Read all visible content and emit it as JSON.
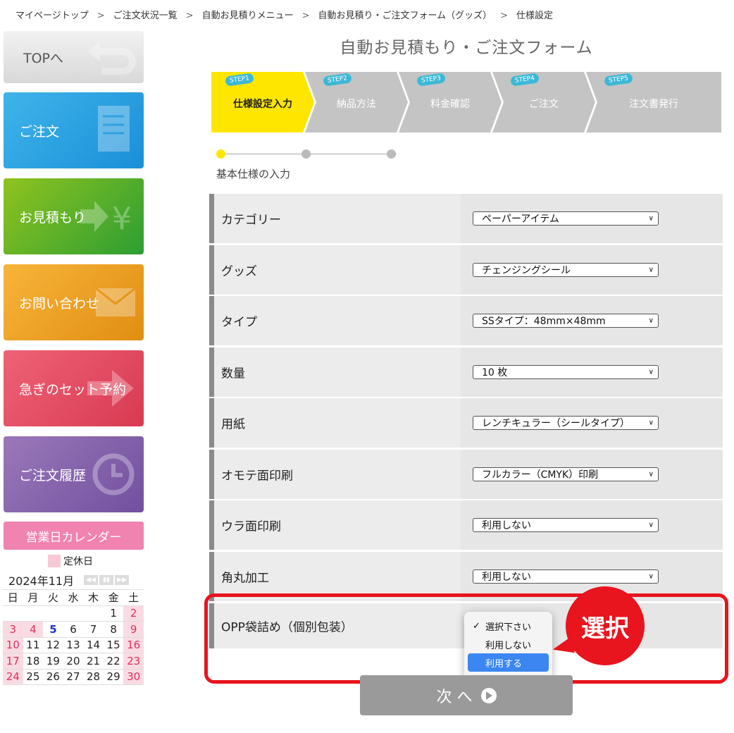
{
  "breadcrumb": {
    "items": [
      "マイページトップ",
      "ご注文状況一覧",
      "自動お見積りメニュー",
      "自動お見積り・ご注文フォーム（グッズ）",
      "仕様設定"
    ],
    "separator": ">"
  },
  "sidebar": {
    "top": "TOPへ",
    "order": "ご注文",
    "estimate": "お見積もり",
    "inquiry": "お問い合わせ",
    "rush": "急ぎのセット予約",
    "history": "ご注文履歴"
  },
  "calendar": {
    "title": "営業日カレンダー",
    "legend": "定休日",
    "month": "2024年11月",
    "weekdays": [
      "日",
      "月",
      "火",
      "水",
      "木",
      "金",
      "土"
    ],
    "weeks": [
      [
        "",
        "",
        "",
        "",
        "",
        "1",
        "2"
      ],
      [
        "3",
        "4",
        "5",
        "6",
        "7",
        "8",
        "9"
      ],
      [
        "10",
        "11",
        "12",
        "13",
        "14",
        "15",
        "16"
      ],
      [
        "17",
        "18",
        "19",
        "20",
        "21",
        "22",
        "23"
      ],
      [
        "24",
        "25",
        "26",
        "27",
        "28",
        "29",
        "30"
      ]
    ],
    "holidays": [
      "2",
      "3",
      "4",
      "9",
      "10",
      "16",
      "17",
      "23",
      "24",
      "30"
    ],
    "today": "5"
  },
  "form_title": "自動お見積もり・ご注文フォーム",
  "steps": [
    {
      "badge": "STEP1",
      "label": "仕様設定入力",
      "active": true
    },
    {
      "badge": "STEP2",
      "label": "納品方法",
      "active": false
    },
    {
      "badge": "STEP3",
      "label": "料金確認",
      "active": false
    },
    {
      "badge": "STEP4",
      "label": "ご注文",
      "active": false
    },
    {
      "badge": "STEP5",
      "label": "注文書発行",
      "active": false
    }
  ],
  "progress": {
    "sub_label": "基本仕様の入力",
    "current": 1,
    "total": 3
  },
  "rows": [
    {
      "label": "カテゴリー",
      "value": "ペーパーアイテム"
    },
    {
      "label": "グッズ",
      "value": "チェンジングシール"
    },
    {
      "label": "タイプ",
      "value": "SSタイプ：48mm×48mm"
    },
    {
      "label": "数量",
      "value": "10 枚"
    },
    {
      "label": "用紙",
      "value": "レンチキュラー（シールタイプ）"
    },
    {
      "label": "オモテ面印刷",
      "value": "フルカラー（CMYK）印刷"
    },
    {
      "label": "ウラ面印刷",
      "value": "利用しない"
    },
    {
      "label": "角丸加工",
      "value": "利用しない"
    }
  ],
  "opp": {
    "label": "OPP袋詰め（個別包装）",
    "options": [
      "選択下さい",
      "利用しない",
      "利用する"
    ],
    "checked": "選択下さい",
    "highlighted": "利用する"
  },
  "callout": "選択",
  "next_button": "次 へ",
  "colors": {
    "highlight": "#e8141e",
    "active_step": "#ffe600",
    "inactive_step": "#c4c4c4"
  }
}
